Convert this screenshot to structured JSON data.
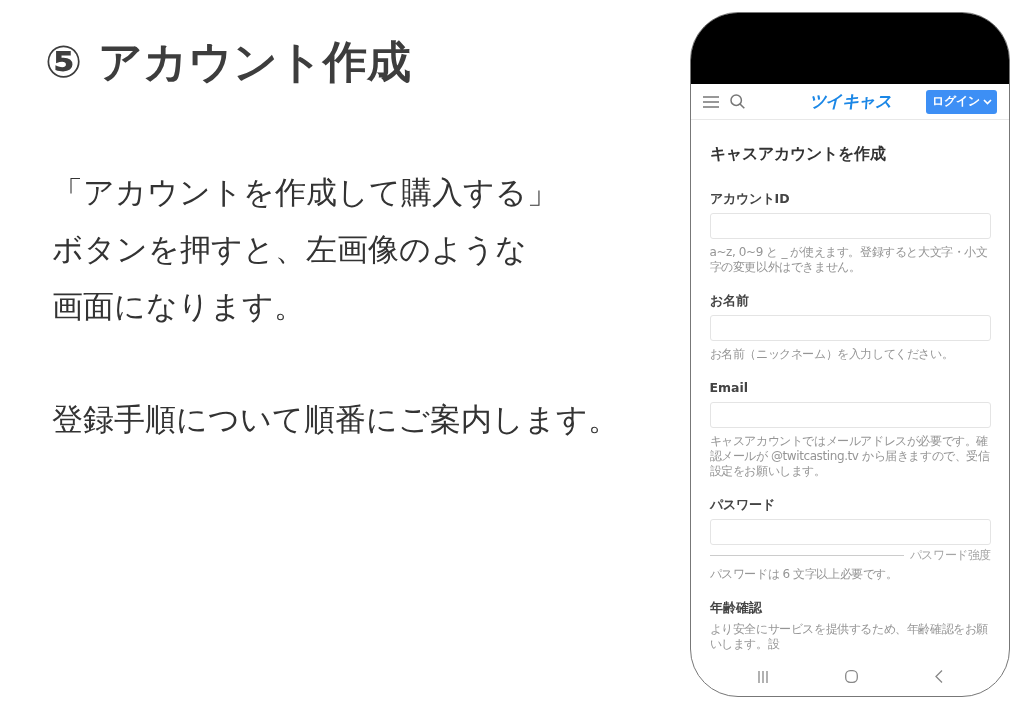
{
  "slide": {
    "title": "⑤ アカウント作成",
    "paragraphs": [
      {
        "lines": [
          "「アカウントを作成して購入する」",
          "ボタンを押すと、左画像のような",
          "画面になります。"
        ]
      },
      {
        "lines": [
          "登録手順について順番にご案内します。"
        ]
      }
    ]
  },
  "phone": {
    "header": {
      "logo": "ツイキャス",
      "login_button": "ログイン"
    },
    "form": {
      "title": "キャスアカウントを作成",
      "fields": [
        {
          "kind": "text",
          "label": "アカウントID",
          "help": "a~z, 0~9 と _ が使えます。登録すると大文字・小文字の変更以外はできません。"
        },
        {
          "kind": "text",
          "label": "お名前",
          "help": "お名前（ニックネーム）を入力してください。"
        },
        {
          "kind": "text",
          "label": "Email",
          "help": "キャスアカウントではメールアドレスが必要です。確認メールが @twitcasting.tv から届きますので、受信設定をお願いします。"
        },
        {
          "kind": "password",
          "label": "パスワード",
          "strength_label": "パスワード強度",
          "help": "パスワードは 6 文字以上必要です。"
        },
        {
          "kind": "notice",
          "label": "年齢確認",
          "text": "より安全にサービスを提供するため、年齢確認をお願いします。設"
        }
      ]
    }
  }
}
